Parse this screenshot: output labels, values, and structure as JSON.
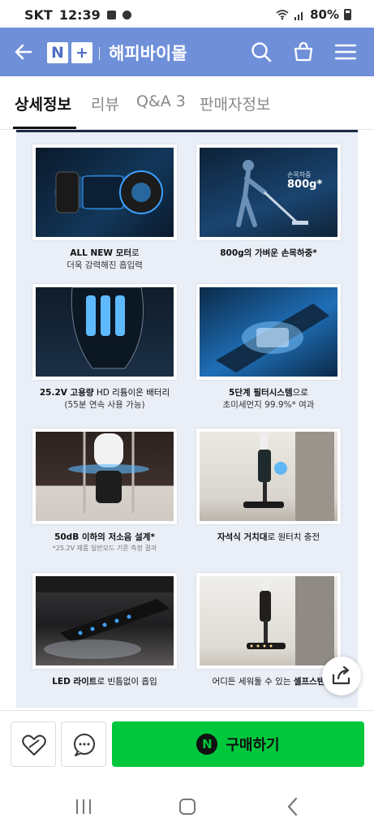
{
  "status_bar": {
    "carrier": "SKT",
    "time": "12:39",
    "battery": "80%"
  },
  "header": {
    "title": "해피바이몰",
    "logo_n": "N",
    "logo_plus": "+"
  },
  "tabs": [
    {
      "label": "상세정보"
    },
    {
      "label": "리뷰"
    },
    {
      "label": "Q&A 3"
    },
    {
      "label": "판매자정보"
    }
  ],
  "features": [
    {
      "line1_bold": "ALL NEW 모터",
      "line1_rest": "로",
      "line2": "더욱 강력해진 흡입력",
      "note": ""
    },
    {
      "line1_bold": "800g의 가벼운 손목하중*",
      "line1_rest": "",
      "line2": "",
      "note": ""
    },
    {
      "line1_bold": "25.2V 고용량",
      "line1_rest": " HD 리튬이온 배터리",
      "line2": "(55분 연속 사용 가능)",
      "note": ""
    },
    {
      "line1_bold": "5단계 필터시스템",
      "line1_rest": "으로",
      "line2": "초미세먼지 99.9%* 여과",
      "note": ""
    },
    {
      "line1_bold": "50dB 이하의 저소음 설계*",
      "line1_rest": "",
      "line2": "",
      "note": "*25.2V 제품 일반모드 기준 측정 결과"
    },
    {
      "line1_bold": "자석식 거치대",
      "line1_rest": "로 원터치 충전",
      "line2": "",
      "note": ""
    },
    {
      "line1_bold": "LED 라이트",
      "line1_rest": "로 빈틈없이 흡입",
      "line2": "",
      "note": ""
    },
    {
      "line1_bold": "",
      "line1_rest": "어디든 세워둘 수 있는 ",
      "line2": "",
      "note": "",
      "line1_tail_bold": "셀프스탠"
    }
  ],
  "photo_labels": {
    "weight_label": "손목하중",
    "weight_value": "800g*"
  },
  "bottom": {
    "buy_label": "구매하기",
    "npay": "N"
  },
  "colors": {
    "header": "#6f8fd9",
    "buy": "#00c73c",
    "content_bg": "#e9eef7"
  }
}
